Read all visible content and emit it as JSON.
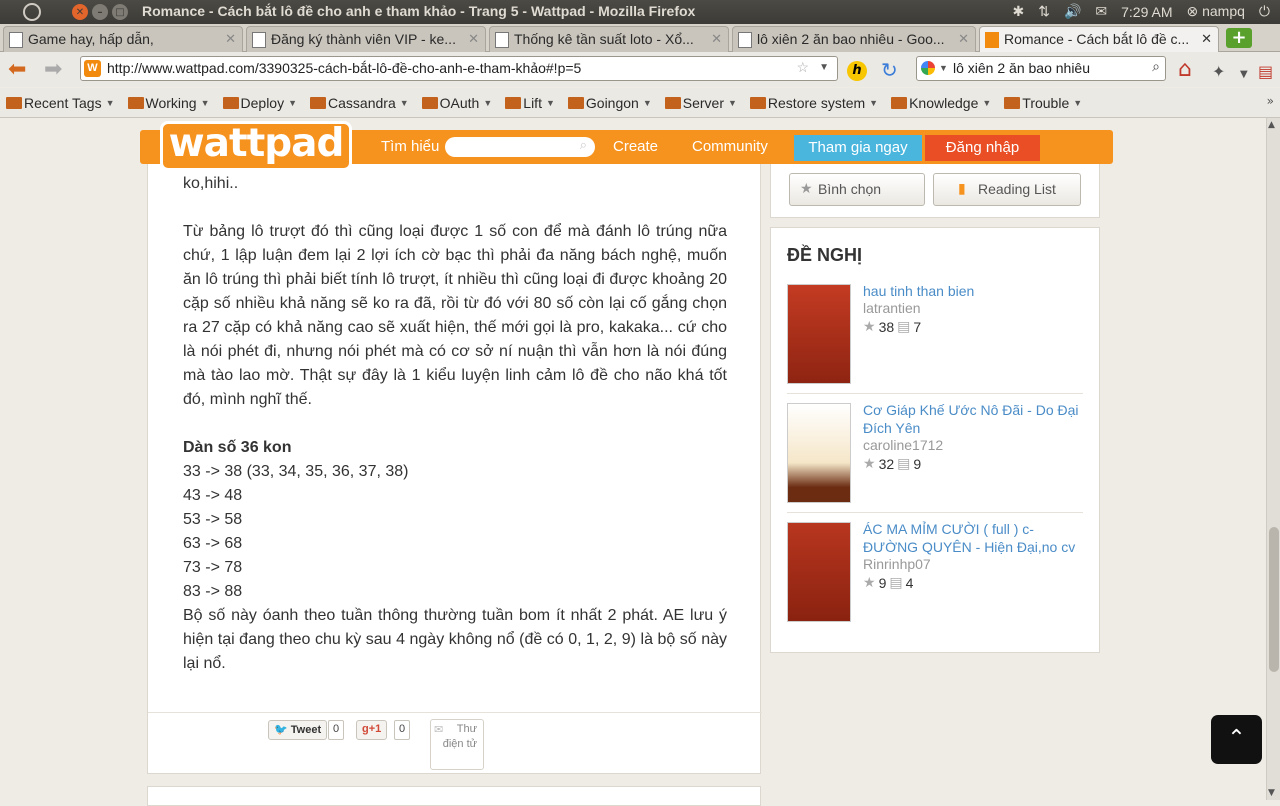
{
  "os": {
    "window_title": "Romance - Cách bắt lô đề cho anh e tham khảo - Trang 5 - Wattpad - Mozilla Firefox",
    "time": "7:29 AM",
    "user": "nampq"
  },
  "tabs": [
    {
      "label": "Game hay, hấp dẫn,"
    },
    {
      "label": "Đăng ký thành viên VIP - ke..."
    },
    {
      "label": "Thống kê tần suất loto - Xổ..."
    },
    {
      "label": "lô xiên 2 ăn bao nhiêu - Goo..."
    },
    {
      "label": "Romance - Cách bắt lô đề c..."
    }
  ],
  "nav": {
    "url": "http://www.wattpad.com/3390325-cách-bắt-lô-đề-cho-anh-e-tham-khảo#!p=5",
    "search": "lô xiên 2 ăn bao nhiêu"
  },
  "bookmarks": [
    "Recent Tags",
    "Working",
    "Deploy",
    "Cassandra",
    "OAuth",
    "Lift",
    "Goingon",
    "Server",
    "Restore system",
    "Knowledge",
    "Trouble"
  ],
  "wattpad": {
    "logo": "wattpad",
    "links": {
      "discover": "Tìm hiểu",
      "create": "Create",
      "community": "Community"
    },
    "join": "Tham gia ngay",
    "login": "Đăng nhập"
  },
  "article": {
    "line0": "ko,hihi..",
    "para1": "Từ bảng lô trượt đó thì cũng loại được 1 số con để mà đánh lô trúng nữa chứ, 1 lập luận đem lại 2 lợi ích cờ bạc thì phải đa năng bách nghệ, muốn ăn lô trúng thì phải biết tính lô trượt, ít nhiều thì cũng loại đi được khoảng 20 cặp số nhiều khả năng sẽ ko ra đã, rồi từ đó với 80 số còn lại cố gắng chọn ra 27 cặp có khả năng cao sẽ xuất hiện, thế mới gọi là pro, kakaka... cứ cho là nói phét đi, nhưng nói phét mà có cơ sở ní nuận thì vẫn hơn là nói đúng mà tào lao mờ. Thật sự đây là 1 kiểu luyện linh cảm lô đề cho não khá tốt đó, mình nghĩ thế.",
    "heading": "Dàn số 36 kon",
    "lines": [
      "33 -> 38 (33, 34, 35, 36, 37, 38)",
      "43 -> 48",
      "53 -> 58",
      "63 -> 68",
      "73 -> 78",
      "83 -> 88"
    ],
    "para2": "Bộ số này óanh theo tuần thông thường tuần bom ít nhất 2 phát. AE lưu ý hiện tại đang theo chu kỳ sau 4 ngày không nổ (đề có 0, 1, 2, 9) là bộ số này lại nổ."
  },
  "share": {
    "tweet": "Tweet",
    "tweet_count": "0",
    "gplus": "+1",
    "gplus_count": "0",
    "email": "Thư điện tử"
  },
  "sidebar": {
    "vote": "Bình chọn",
    "reading_list": "Reading List",
    "rec_title": "ĐỀ NGHỊ",
    "books": [
      {
        "title": "hau tinh than bien",
        "author": "latrantien",
        "votes": "38",
        "comments": "7"
      },
      {
        "title": "Cơ Giáp Khế Ước Nô Đãi - Do Đại Đích Yên",
        "author": "caroline1712",
        "votes": "32",
        "comments": "9"
      },
      {
        "title": "ÁC MA MỈM CƯỜI ( full ) c- ĐƯỜNG QUYÊN - Hiện Đại,no cv",
        "author": "Rinrinhp07",
        "votes": "9",
        "comments": "4"
      }
    ]
  },
  "colors": {
    "wattpad_orange": "#f6921e",
    "join_blue": "#4ab6de",
    "login_red": "#e94e24",
    "link_blue": "#4a8cc7"
  }
}
